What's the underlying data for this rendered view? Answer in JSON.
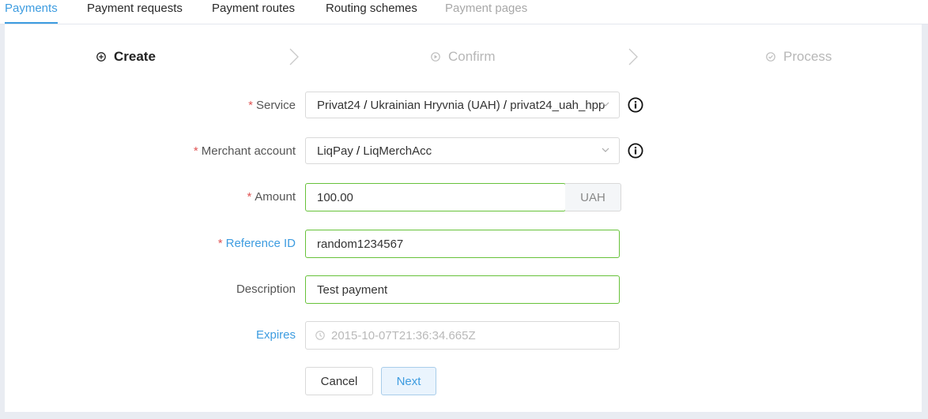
{
  "tabs": [
    {
      "label": "Payments",
      "state": "active"
    },
    {
      "label": "Payment requests",
      "state": "normal"
    },
    {
      "label": "Payment routes",
      "state": "normal"
    },
    {
      "label": "Routing schemes",
      "state": "normal"
    },
    {
      "label": "Payment pages",
      "state": "disabled"
    }
  ],
  "steps": [
    {
      "label": "Create",
      "icon": "plus-circle-icon"
    },
    {
      "label": "Confirm",
      "icon": "play-circle-icon"
    },
    {
      "label": "Process",
      "icon": "check-circle-icon"
    }
  ],
  "form": {
    "required_mark": "*",
    "service": {
      "label": "Service",
      "value_part1": "Privat24",
      "value_part2": "Ukrainian Hryvnia (UAH)",
      "value_part3": "privat24_uah_hpp",
      "separator": "/"
    },
    "merchant": {
      "label": "Merchant account",
      "value_part1": "LiqPay",
      "value_part2": "LiqMerchAcc",
      "separator": "/"
    },
    "amount": {
      "label": "Amount",
      "value": "100.00",
      "unit": "UAH"
    },
    "reference": {
      "label": "Reference ID",
      "value": "random1234567"
    },
    "description": {
      "label": "Description",
      "value": "Test payment"
    },
    "expires": {
      "label": "Expires",
      "placeholder": "2015-10-07T21:36:34.665Z"
    }
  },
  "buttons": {
    "cancel": "Cancel",
    "next": "Next"
  },
  "colors": {
    "accent": "#3d9ce0",
    "valid_border": "#67c23a",
    "required": "#e05454"
  }
}
